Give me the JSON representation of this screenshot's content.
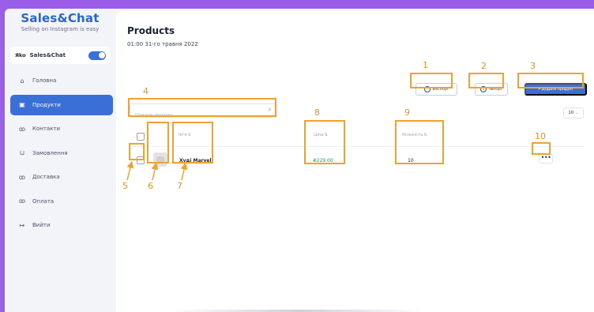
{
  "brand": {
    "title": "Sales&Chat",
    "subtitle": "Selling on Instagram is easy"
  },
  "store": {
    "logo": "Яko",
    "name": "Sales&Chat",
    "toggle_on": true
  },
  "nav": {
    "items": [
      {
        "label": "Головна",
        "icon": "home-icon",
        "glyph": "⌂"
      },
      {
        "label": "Продукти",
        "icon": "box-icon",
        "glyph": "▣"
      },
      {
        "label": "Контакти",
        "icon": "users-icon",
        "glyph": "ꝏ"
      },
      {
        "label": "Замовлення",
        "icon": "cart-icon",
        "glyph": "⊔"
      },
      {
        "label": "Доставка",
        "icon": "users-icon",
        "glyph": "ꝏ"
      },
      {
        "label": "Оплата",
        "icon": "users-icon",
        "glyph": "ꝏ"
      },
      {
        "label": "Вийти",
        "icon": "logout-icon",
        "glyph": "↦"
      }
    ],
    "active": "Продукти"
  },
  "page": {
    "title": "Products",
    "date": "01:00 31-го травня 2022"
  },
  "toolbar": {
    "export_label": "Експорт",
    "import_label": "Імпорт",
    "add_label": "+ Додати продукт"
  },
  "search": {
    "placeholder": "Шукати продукт..."
  },
  "per_page": {
    "value": "10"
  },
  "table": {
    "headers": {
      "name": "Ім'я",
      "price": "Ціна",
      "quantity": "Кількість"
    },
    "rows": [
      {
        "name": "Худі Marvel",
        "price": "₴229.00",
        "quantity": "10",
        "actions": "•••"
      }
    ]
  },
  "annotations": [
    "1",
    "2",
    "3",
    "4",
    "5",
    "6",
    "7",
    "8",
    "9",
    "10"
  ],
  "colors": {
    "accent": "#3b6fd8",
    "price": "#1ea34a",
    "annotation": "#f2a12e",
    "frame": "#9a5fe6"
  }
}
